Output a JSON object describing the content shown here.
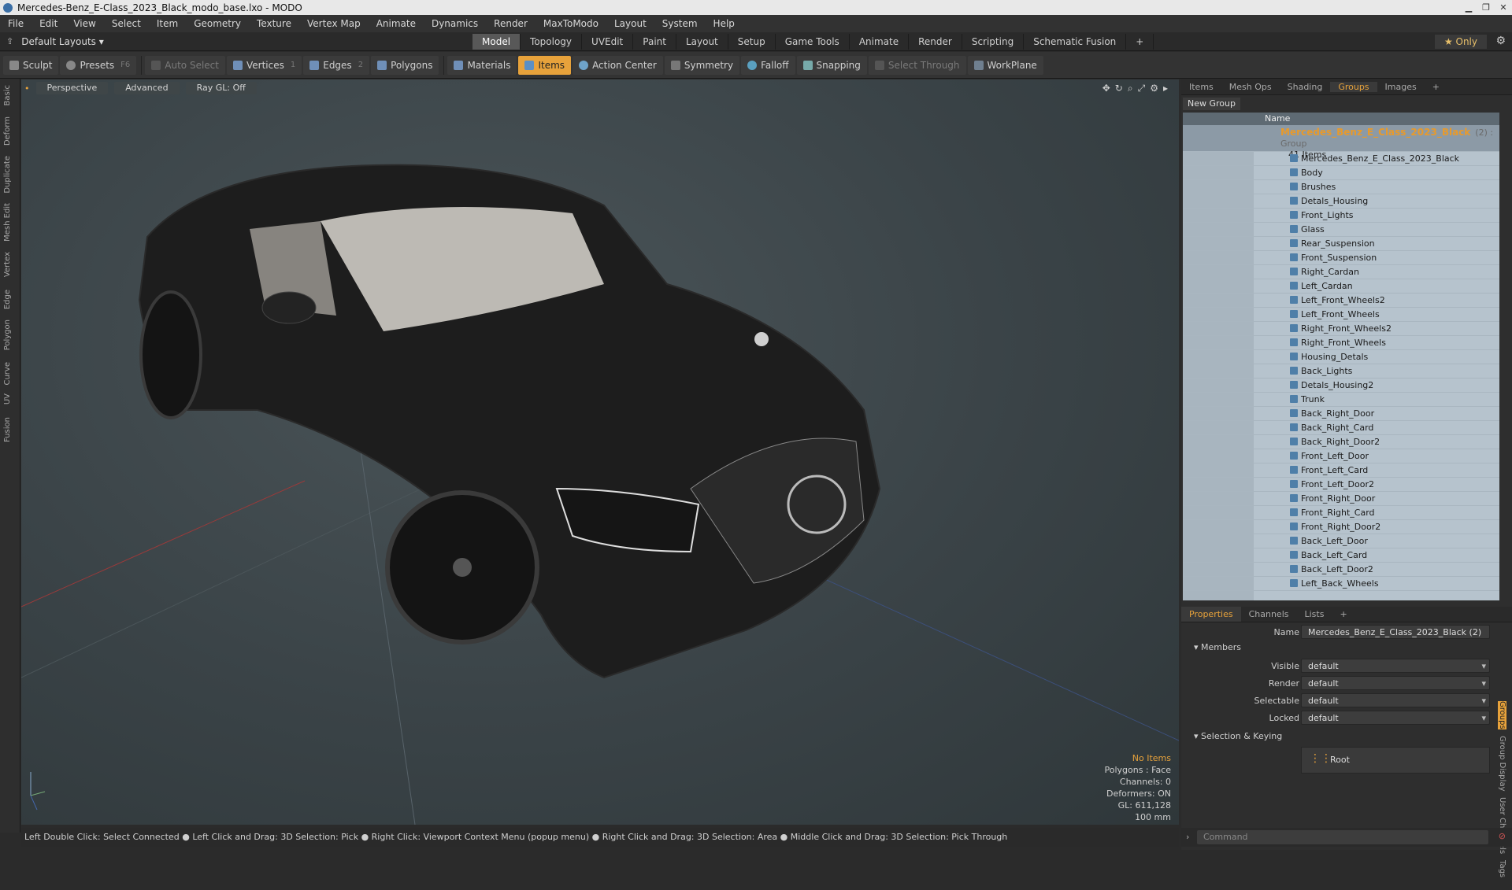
{
  "window": {
    "title": "Mercedes-Benz_E-Class_2023_Black_modo_base.lxo - MODO"
  },
  "menu": [
    "File",
    "Edit",
    "View",
    "Select",
    "Item",
    "Geometry",
    "Texture",
    "Vertex Map",
    "Animate",
    "Dynamics",
    "Render",
    "MaxToModo",
    "Layout",
    "System",
    "Help"
  ],
  "layout": {
    "selector": "Default Layouts ▾",
    "tabs": [
      "Model",
      "Topology",
      "UVEdit",
      "Paint",
      "Layout",
      "Setup",
      "Game Tools",
      "Animate",
      "Render",
      "Scripting",
      "Schematic Fusion",
      "+"
    ],
    "active_tab": "Model",
    "only_label": "★  Only"
  },
  "toolbar": {
    "sculpt": "Sculpt",
    "presets": "Presets",
    "presets_key": "F6",
    "auto_select": "Auto Select",
    "vertices": "Vertices",
    "vertices_key": "1",
    "edges": "Edges",
    "edges_key": "2",
    "polygons": "Polygons",
    "materials": "Materials",
    "items": "Items",
    "action_center": "Action Center",
    "symmetry": "Symmetry",
    "falloff": "Falloff",
    "snapping": "Snapping",
    "select_through": "Select Through",
    "workplane": "WorkPlane"
  },
  "left_tabs": [
    "Basic",
    "Deform",
    "Duplicate",
    "Mesh Edit",
    "Vertex",
    "Edge",
    "Polygon",
    "Curve",
    "UV",
    "Fusion"
  ],
  "viewport": {
    "view_mode": "Perspective",
    "shading": "Advanced",
    "raygl": "Ray GL: Off",
    "info": {
      "items": "No Items",
      "polygons": "Polygons : Face",
      "channels": "Channels: 0",
      "deformers": "Deformers: ON",
      "gl": "GL: 611,128",
      "scale": "100 mm"
    }
  },
  "status_bar": "Left Double Click: Select Connected ● Left Click and Drag: 3D Selection: Pick ● Right Click: Viewport Context Menu (popup menu) ● Right Click and Drag: 3D Selection: Area ● Middle Click and Drag: 3D Selection: Pick Through",
  "right_panel": {
    "tabs": [
      "Items",
      "Mesh Ops",
      "Shading",
      "Groups",
      "Images",
      "+"
    ],
    "active_tab": "Groups",
    "new_group": "New Group",
    "column_name": "Name",
    "group": {
      "name": "Mercedes_Benz_E_Class_2023_Black",
      "suffix": "(2) : Group",
      "count": "41 Items",
      "members": [
        "Mercedes_Benz_E_Class_2023_Black",
        "Body",
        "Brushes",
        "Detals_Housing",
        "Front_Lights",
        "Glass",
        "Rear_Suspension",
        "Front_Suspension",
        "Right_Cardan",
        "Left_Cardan",
        "Left_Front_Wheels2",
        "Left_Front_Wheels",
        "Right_Front_Wheels2",
        "Right_Front_Wheels",
        "Housing_Detals",
        "Back_Lights",
        "Detals_Housing2",
        "Trunk",
        "Back_Right_Door",
        "Back_Right_Card",
        "Back_Right_Door2",
        "Front_Left_Door",
        "Front_Left_Card",
        "Front_Left_Door2",
        "Front_Right_Door",
        "Front_Right_Card",
        "Front_Right_Door2",
        "Back_Left_Door",
        "Back_Left_Card",
        "Back_Left_Door2",
        "Left_Back_Wheels"
      ]
    }
  },
  "properties": {
    "tabs": [
      "Properties",
      "Channels",
      "Lists",
      "+"
    ],
    "active_tab": "Properties",
    "name_label": "Name",
    "name_value": "Mercedes_Benz_E_Class_2023_Black (2)",
    "members_section": "Members",
    "visible_label": "Visible",
    "visible_value": "default",
    "render_label": "Render",
    "render_value": "default",
    "selectable_label": "Selectable",
    "selectable_value": "default",
    "locked_label": "Locked",
    "locked_value": "default",
    "selkey_section": "Selection & Keying",
    "root_label": "Root",
    "side_tabs": [
      "Groups",
      "Group Display",
      "User Channels",
      "Tags"
    ]
  },
  "command": {
    "placeholder": "Command"
  }
}
